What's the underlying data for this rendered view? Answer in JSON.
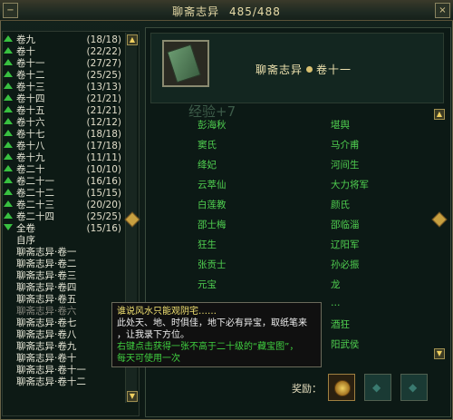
{
  "window": {
    "title": "聊斋志异",
    "progress_text": "485/488",
    "minimize_label": "−",
    "close_label": "×"
  },
  "colors": {
    "accent_green": "#38c040",
    "name_green": "#50d050",
    "title_gold": "#e9dca8"
  },
  "list": {
    "items": [
      {
        "label": "卷九",
        "count": "(18/18)",
        "icon": "expand-arrow-icon"
      },
      {
        "label": "卷十",
        "count": "(22/22)",
        "icon": "expand-arrow-icon"
      },
      {
        "label": "卷十一",
        "count": "(27/27)",
        "icon": "expand-arrow-icon"
      },
      {
        "label": "卷十二",
        "count": "(25/25)",
        "icon": "expand-arrow-icon"
      },
      {
        "label": "卷十三",
        "count": "(13/13)",
        "icon": "expand-arrow-icon"
      },
      {
        "label": "卷十四",
        "count": "(21/21)",
        "icon": "expand-arrow-icon"
      },
      {
        "label": "卷十五",
        "count": "(21/21)",
        "icon": "expand-arrow-icon"
      },
      {
        "label": "卷十六",
        "count": "(12/12)",
        "icon": "expand-arrow-icon"
      },
      {
        "label": "卷十七",
        "count": "(18/18)",
        "icon": "expand-arrow-icon"
      },
      {
        "label": "卷十八",
        "count": "(17/18)",
        "icon": "expand-arrow-icon"
      },
      {
        "label": "卷十九",
        "count": "(11/11)",
        "icon": "expand-arrow-icon"
      },
      {
        "label": "卷二十",
        "count": "(10/10)",
        "icon": "expand-arrow-icon"
      },
      {
        "label": "卷二十一",
        "count": "(16/16)",
        "icon": "expand-arrow-icon"
      },
      {
        "label": "卷二十二",
        "count": "(15/15)",
        "icon": "expand-arrow-icon"
      },
      {
        "label": "卷二十三",
        "count": "(20/20)",
        "icon": "expand-arrow-icon"
      },
      {
        "label": "卷二十四",
        "count": "(25/25)",
        "icon": "expand-arrow-icon"
      },
      {
        "label": "全卷",
        "count": "(15/16)",
        "icon": "collapse-arrow-icon"
      }
    ],
    "subitems": [
      "自序",
      "聊斋志异·卷一",
      "聊斋志异·卷二",
      "聊斋志异·卷三",
      "聊斋志异·卷四",
      "聊斋志异·卷五",
      "聊斋志异·卷六",
      "聊斋志异·卷七",
      "聊斋志异·卷八",
      "聊斋志异·卷九",
      "聊斋志异·卷十",
      "聊斋志异·卷十一",
      "聊斋志异·卷十二"
    ]
  },
  "detail": {
    "book_title_left": "聊斋志异",
    "book_title_right": "卷十一",
    "watermark": "经验+7",
    "names_col1": [
      "彭海秋",
      "窦氏",
      "绛妃",
      "云萃仙",
      "白莲教",
      "邵士梅",
      "狂生",
      "张贡士",
      "元宝",
      "…"
    ],
    "names_col2": [
      "堪舆",
      "马介甫",
      "河间生",
      "大力将军",
      "颜氏",
      "邵临淄",
      "辽阳军",
      "孙必振",
      "龙",
      "…",
      "酒狂",
      "阳武侯"
    ]
  },
  "tooltip": {
    "line1": "谁说风水只能观阴宅……",
    "line2": "此处天、地、时俱佳，地下必有异宝，取纸笔来",
    "line3": "，让我录下方位。",
    "line4": "右键点击获得一张不高于二十级的“藏宝图”，",
    "line5": "每天可使用一次"
  },
  "reward": {
    "label": "奖励："
  }
}
